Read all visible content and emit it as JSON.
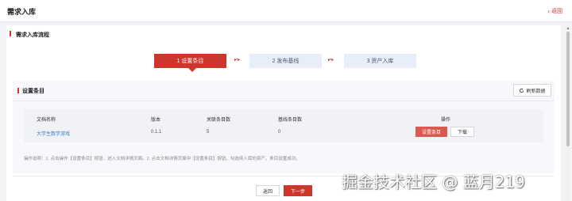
{
  "header": {
    "title": "需求入库",
    "back_label": "返回"
  },
  "section": {
    "title": "需求入库流程"
  },
  "steps": [
    {
      "label": "1 设置条目",
      "active": true
    },
    {
      "label": "2 发布基线",
      "active": false
    },
    {
      "label": "3 资产入库",
      "active": false
    }
  ],
  "panel": {
    "title": "设置条目",
    "refresh_label": "刷新数据",
    "columns": {
      "doc_name": "文档名称",
      "version": "版本",
      "linked_count": "关联条目数",
      "baseline_count": "基线条目数",
      "actions": "操作"
    },
    "rows": [
      {
        "doc_name": "大学生数学游戏",
        "version": "0.1.1",
        "linked_count": "5",
        "baseline_count": "0",
        "primary_action": "设置条目",
        "secondary_action": "下载"
      }
    ],
    "instructions": "操作说明：1. 点击操作【设置条目】按钮，进入文档详情页面。2. 点击文档详情页面中【设置条目】按钮，勾选待入库的资产，条目设置成功。"
  },
  "footer": {
    "back_label": "返回",
    "next_label": "下一步"
  },
  "watermark": "掘金技术社区 @ 蓝月219",
  "colors": {
    "accent": "#cc362d",
    "link": "#3e7ac6",
    "step_inactive": "#e7eefa"
  }
}
